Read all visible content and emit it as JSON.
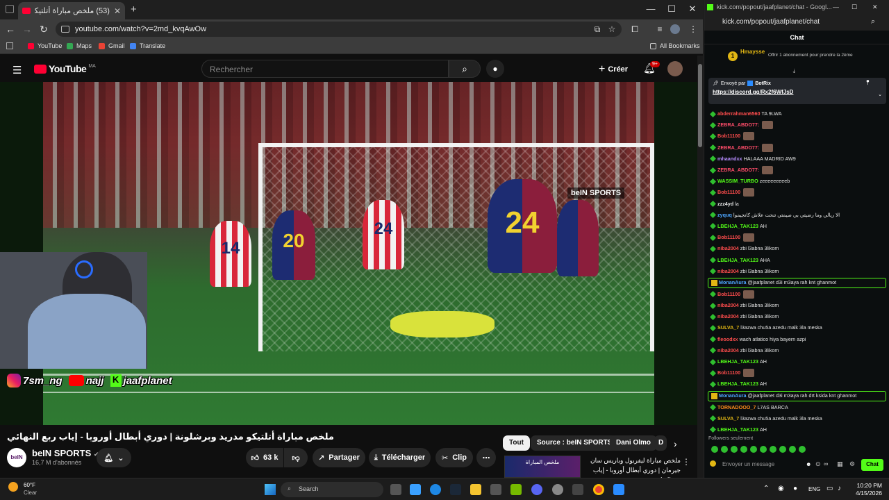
{
  "browser": {
    "tab_title": "(53) ملخص مباراة أتلتيكو مدريد",
    "url": "youtube.com/watch?v=2md_kvqAwOw",
    "bookmarks": [
      {
        "label": "YouTube",
        "color": "#ff0033"
      },
      {
        "label": "Maps",
        "color": "#34a853"
      },
      {
        "label": "Gmail",
        "color": "#ea4335"
      },
      {
        "label": "Translate",
        "color": "#4285f4"
      }
    ],
    "all_bookmarks": "All Bookmarks"
  },
  "youtube": {
    "logo": "YouTube",
    "region": "MA",
    "search_placeholder": "Rechercher",
    "create_label": "Créer",
    "notifications": "9+",
    "video": {
      "overlay_brand": "beIN SPORTS",
      "socials": [
        "7sm_ng",
        "najj",
        "jaafplanet"
      ],
      "jersey_numbers": [
        "14",
        "20",
        "24",
        "24"
      ]
    },
    "title": "ملخص مباراة أتلتيكو مدريد وبرشلونة | دوري أبطال أوروبا - إياب ربع النهائي",
    "channel": {
      "name": "beIN SPORTS",
      "subs": "16,7 M d'abonnés",
      "avatar_text": "beIN"
    },
    "actions": {
      "likes": "63 k",
      "share": "Partager",
      "download": "Télécharger",
      "clip": "Clip"
    },
    "chips": [
      "Tout",
      "Source : beIN SPORTS",
      "Dani Olmo",
      "D"
    ],
    "recommended": {
      "title": "ملخص مباراة ليفربول وباريس سان جيرمان | دوري أبطال أوروبا - إياب ربع النهائي",
      "thumb_text": "ملخص المباراة"
    }
  },
  "kick": {
    "window_title": "kick.com/popout/jaafplanet/chat - Googl...",
    "url": "kick.com/popout/jaafplanet/chat",
    "header": "Chat",
    "sub_event": {
      "user": "Hmaysse",
      "count": "1",
      "text": "Offrir 1 abonnement pour prendre la 2ème"
    },
    "pinned": {
      "sent_by": "Envoyé par",
      "bot": "BotRix",
      "link": "https://discord.gg/Rx2f6WfJsD"
    },
    "messages": [
      {
        "user": "abderrahman6560",
        "color": "#ff4d4d",
        "text": "TA 9LWA",
        "emote": false,
        "hl": false
      },
      {
        "user": "ZEBRA_ABDO77:",
        "color": "#ff4d6a",
        "text": "",
        "emote": true,
        "hl": false
      },
      {
        "user": "Bob11100",
        "color": "#ff4d4d",
        "text": "",
        "emote": true,
        "hl": false
      },
      {
        "user": "ZEBRA_ABDO77:",
        "color": "#ff4d6a",
        "text": "",
        "emote": true,
        "hl": false
      },
      {
        "user": "mhaandxx",
        "color": "#b68cff",
        "text": "HALAAA MADRID AW9",
        "emote": false,
        "hl": false
      },
      {
        "user": "ZEBRA_ABDO77:",
        "color": "#ff4d6a",
        "text": "",
        "emote": true,
        "hl": false
      },
      {
        "user": "WASSIM_TURBO",
        "color": "#53fc18",
        "text": "zeeeeeeeeeb",
        "emote": false,
        "hl": false
      },
      {
        "user": "Bob11100",
        "color": "#ff4d4d",
        "text": "",
        "emote": true,
        "hl": false
      },
      {
        "user": "zzz4yd",
        "color": "#e6e6e6",
        "text": "la",
        "emote": false,
        "hl": false
      },
      {
        "user": "zyquq",
        "color": "#4da6ff",
        "text": "الا ريالي وما رضيتي بي صيمتي تنحت علاش كانجيموا",
        "emote": false,
        "hl": false
      },
      {
        "user": "LBEHJA_TAK123",
        "color": "#53fc18",
        "text": "AH",
        "emote": false,
        "hl": false
      },
      {
        "user": "Bob11100",
        "color": "#ff4d4d",
        "text": "",
        "emote": true,
        "hl": false
      },
      {
        "user": "niba2004",
        "color": "#ff4d4d",
        "text": "zbi l3abna 3likom",
        "emote": false,
        "hl": false
      },
      {
        "user": "LBEHJA_TAK123",
        "color": "#53fc18",
        "text": "AHA",
        "emote": false,
        "hl": false
      },
      {
        "user": "niba2004",
        "color": "#ff4d4d",
        "text": "zbi l3abna 3likom",
        "emote": false,
        "hl": false
      },
      {
        "user": "MonanAura",
        "color": "#4da6ff",
        "text": "@jaafplanet d3i m3aya rah knt ghanmot",
        "emote": false,
        "hl": true
      },
      {
        "user": "Bob11100",
        "color": "#ff4d4d",
        "text": "",
        "emote": true,
        "hl": false
      },
      {
        "user": "niba2004",
        "color": "#ff4d4d",
        "text": "zbi l3abna 3likom",
        "emote": false,
        "hl": false
      },
      {
        "user": "niba2004",
        "color": "#ff4d4d",
        "text": "zbi l3abna 3likom",
        "emote": false,
        "hl": false
      },
      {
        "user": "SULVA_7",
        "color": "#e2b714",
        "text": "l3azwa chu5a azedu malk 3la meska",
        "emote": false,
        "hl": false
      },
      {
        "user": "fleoodxx",
        "color": "#ff4d4d",
        "text": "wach atlatico hiya bayern azpi",
        "emote": false,
        "hl": false
      },
      {
        "user": "niba2004",
        "color": "#ff4d4d",
        "text": "zbi l3abna 3likom",
        "emote": false,
        "hl": false
      },
      {
        "user": "LBEHJA_TAK123",
        "color": "#53fc18",
        "text": "AH",
        "emote": false,
        "hl": false
      },
      {
        "user": "Bob11100",
        "color": "#ff4d4d",
        "text": "",
        "emote": true,
        "hl": false
      },
      {
        "user": "LBEHJA_TAK123",
        "color": "#53fc18",
        "text": "AH",
        "emote": false,
        "hl": false
      },
      {
        "user": "MonanAura",
        "color": "#4da6ff",
        "text": "@jaafplanet d3i m3aya rah drt ksida knt ghanmot",
        "emote": false,
        "hl": true
      },
      {
        "user": "TORNADOOO_7",
        "color": "#ff8c1a",
        "text": "L7AS BARCA",
        "emote": false,
        "hl": false
      },
      {
        "user": "SULVA_7",
        "color": "#e2b714",
        "text": "l3azwa chu5a azedu malk 3la meska",
        "emote": false,
        "hl": false
      },
      {
        "user": "LBEHJA_TAK123",
        "color": "#53fc18",
        "text": "AH",
        "emote": false,
        "hl": false
      }
    ],
    "followers_only": "Followers seulement",
    "input_placeholder": "Envoyer un message",
    "send_label": "Chat"
  },
  "taskbar": {
    "weather_temp": "60°F",
    "weather_desc": "Clear",
    "search_placeholder": "Search",
    "lang": "ENG",
    "time": "10:20 PM",
    "date": "4/15/2026"
  }
}
